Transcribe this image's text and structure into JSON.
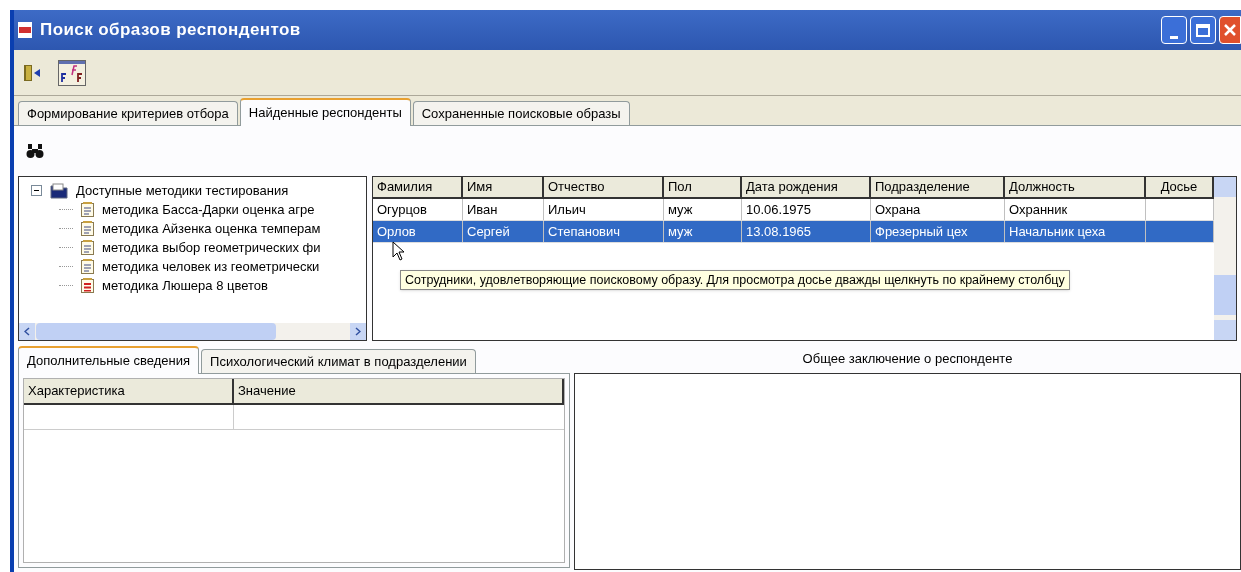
{
  "window": {
    "title": "Поиск образов респондентов"
  },
  "tabs": [
    {
      "label": "Формирование критериев отбора",
      "selected": false
    },
    {
      "label": "Найденные респонденты",
      "selected": true
    },
    {
      "label": "Сохраненные поисковые образы",
      "selected": false
    }
  ],
  "tree": {
    "label": "Доступные методики тестирования",
    "expanded": true,
    "children": [
      {
        "label": "методика Басса-Дарки оценка агре",
        "kind": "document"
      },
      {
        "label": "методика Айзенка оценка темперам",
        "kind": "document"
      },
      {
        "label": "методика выбор геометрических фи",
        "kind": "document"
      },
      {
        "label": "методика человек из геометрически",
        "kind": "document"
      },
      {
        "label": "методика Люшера 8 цветов",
        "kind": "colored-document"
      }
    ]
  },
  "table": {
    "columns": [
      "Фамилия",
      "Имя",
      "Отчество",
      "Пол",
      "Дата рождения",
      "Подразделение",
      "Должность",
      "Досье"
    ],
    "rows": [
      {
        "cells": [
          "Огурцов",
          "Иван",
          "Ильич",
          "муж",
          "10.06.1975",
          "Охрана",
          "Охранник",
          ""
        ],
        "selected": false
      },
      {
        "cells": [
          "Орлов",
          "Сергей",
          "Степанович",
          "муж",
          "13.08.1965",
          "Фрезерный цех",
          "Начальник цеха",
          ""
        ],
        "selected": true
      }
    ]
  },
  "tooltip": "Сотрудники, удовлетворяющие поисковому образу. Для просмотра досье дважды щелкнуть по крайнему столбцу",
  "bottom_tabs": [
    {
      "label": "Дополнительные сведения",
      "selected": true
    },
    {
      "label": "Психологический климат в подразделении",
      "selected": false
    }
  ],
  "details_table": {
    "columns": [
      "Характеристика",
      "Значение"
    ]
  },
  "conclusion": {
    "title": "Общее заключение о респонденте"
  }
}
